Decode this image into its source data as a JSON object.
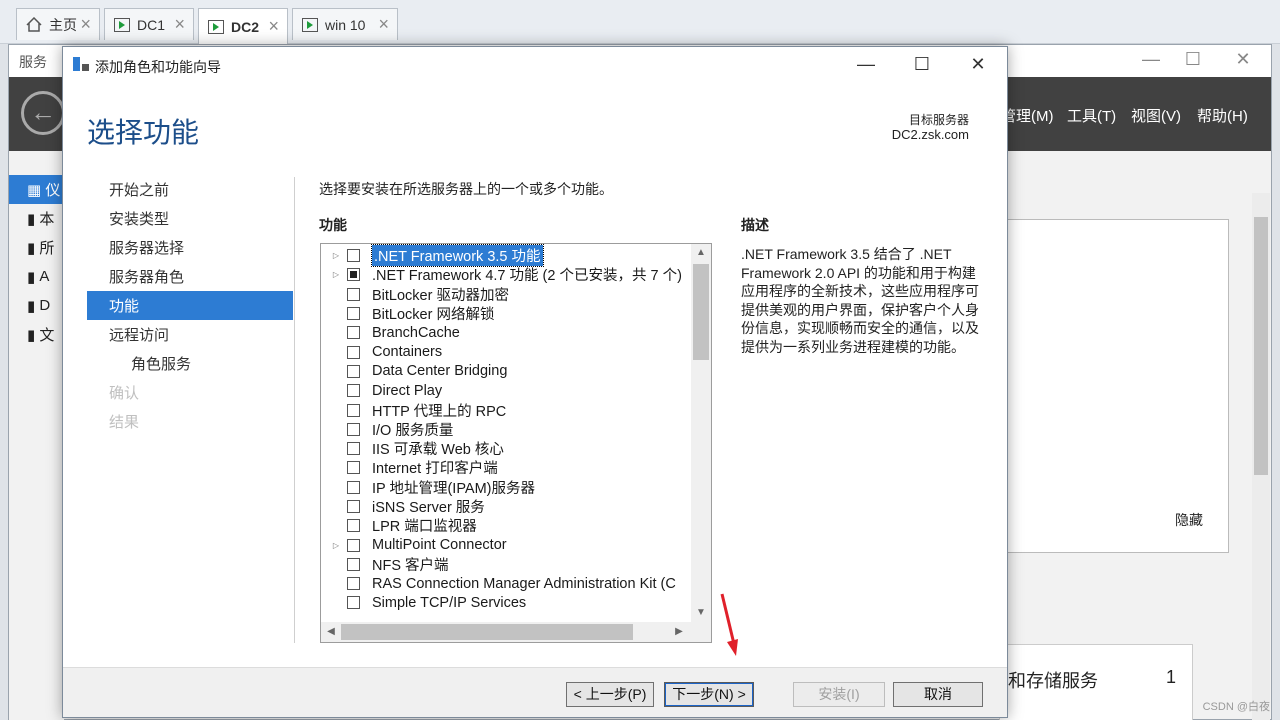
{
  "vm_tabs": [
    {
      "label": "主页",
      "icon": "home-icon"
    },
    {
      "label": "DC1",
      "icon": "vm-icon"
    },
    {
      "label": "DC2",
      "icon": "vm-icon"
    },
    {
      "label": "win 10",
      "icon": "vm-icon"
    }
  ],
  "background_window": {
    "title": "服务",
    "menu": [
      "管理(M)",
      "工具(T)",
      "视图(V)",
      "帮助(H)"
    ],
    "side_items": [
      "仪",
      "本",
      "所",
      "A",
      "D",
      "文"
    ],
    "card_hide_label": "隐藏",
    "tile": {
      "name": "和存储服务",
      "count": "1"
    }
  },
  "dialog": {
    "title": "添加角色和功能向导",
    "heading": "选择功能",
    "target_label": "目标服务器",
    "target_server": "DC2.zsk.com",
    "nav": [
      {
        "label": "开始之前",
        "state": "normal"
      },
      {
        "label": "安装类型",
        "state": "normal"
      },
      {
        "label": "服务器选择",
        "state": "normal"
      },
      {
        "label": "服务器角色",
        "state": "normal"
      },
      {
        "label": "功能",
        "state": "selected"
      },
      {
        "label": "远程访问",
        "state": "normal"
      },
      {
        "label": "角色服务",
        "state": "sub"
      },
      {
        "label": "确认",
        "state": "disabled"
      },
      {
        "label": "结果",
        "state": "disabled"
      }
    ],
    "instruction": "选择要安装在所选服务器上的一个或多个功能。",
    "features_header": "功能",
    "description_header": "描述",
    "description": ".NET Framework 3.5 结合了 .NET Framework 2.0 API 的功能和用于构建应用程序的全新技术，这些应用程序可提供美观的用户界面，保护客户个人身份信息，实现顺畅而安全的通信，以及提供为一系列业务进程建模的功能。",
    "features": [
      {
        "label": ".NET Framework 3.5 功能",
        "expandable": true,
        "state": "unchecked",
        "highlighted": true
      },
      {
        "label": ".NET Framework 4.7 功能 (2 个已安装，共 7 个)",
        "expandable": true,
        "state": "indeterminate",
        "highlighted": false
      },
      {
        "label": "BitLocker 驱动器加密",
        "expandable": false,
        "state": "unchecked",
        "highlighted": false
      },
      {
        "label": "BitLocker 网络解锁",
        "expandable": false,
        "state": "unchecked",
        "highlighted": false
      },
      {
        "label": "BranchCache",
        "expandable": false,
        "state": "unchecked",
        "highlighted": false
      },
      {
        "label": "Containers",
        "expandable": false,
        "state": "unchecked",
        "highlighted": false
      },
      {
        "label": "Data Center Bridging",
        "expandable": false,
        "state": "unchecked",
        "highlighted": false
      },
      {
        "label": "Direct Play",
        "expandable": false,
        "state": "unchecked",
        "highlighted": false
      },
      {
        "label": "HTTP 代理上的 RPC",
        "expandable": false,
        "state": "unchecked",
        "highlighted": false
      },
      {
        "label": "I/O 服务质量",
        "expandable": false,
        "state": "unchecked",
        "highlighted": false
      },
      {
        "label": "IIS 可承载 Web 核心",
        "expandable": false,
        "state": "unchecked",
        "highlighted": false
      },
      {
        "label": "Internet 打印客户端",
        "expandable": false,
        "state": "unchecked",
        "highlighted": false
      },
      {
        "label": "IP 地址管理(IPAM)服务器",
        "expandable": false,
        "state": "unchecked",
        "highlighted": false
      },
      {
        "label": "iSNS Server 服务",
        "expandable": false,
        "state": "unchecked",
        "highlighted": false
      },
      {
        "label": "LPR 端口监视器",
        "expandable": false,
        "state": "unchecked",
        "highlighted": false
      },
      {
        "label": "MultiPoint Connector",
        "expandable": true,
        "state": "unchecked",
        "highlighted": false
      },
      {
        "label": "NFS 客户端",
        "expandable": false,
        "state": "unchecked",
        "highlighted": false
      },
      {
        "label": "RAS Connection Manager Administration Kit (C",
        "expandable": false,
        "state": "unchecked",
        "highlighted": false
      },
      {
        "label": "Simple TCP/IP Services",
        "expandable": false,
        "state": "unchecked",
        "highlighted": false
      }
    ],
    "buttons": {
      "previous": "< 上一步(P)",
      "next": "下一步(N) >",
      "install": "安装(I)",
      "cancel": "取消"
    }
  },
  "watermark": "CSDN @白夜",
  "colors": {
    "accent": "#2d7cd3",
    "heading": "#1c4e8a",
    "annotation_arrow": "#e0202a"
  }
}
